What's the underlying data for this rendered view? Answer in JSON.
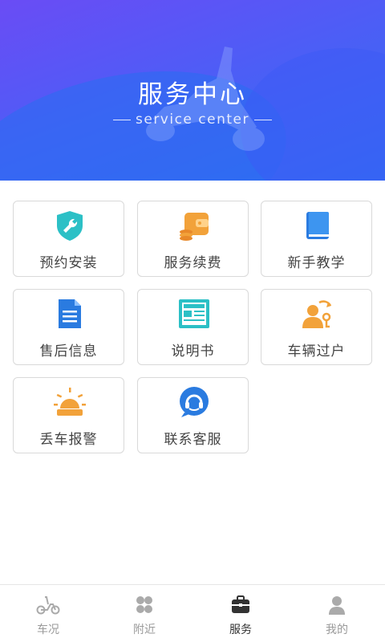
{
  "header": {
    "title": "服务中心",
    "subtitle": "service center"
  },
  "services": [
    {
      "label": "预约安装",
      "icon": "shield-wrench-icon"
    },
    {
      "label": "服务续费",
      "icon": "wallet-coins-icon"
    },
    {
      "label": "新手教学",
      "icon": "book-icon"
    },
    {
      "label": "售后信息",
      "icon": "document-icon"
    },
    {
      "label": "说明书",
      "icon": "manual-screen-icon"
    },
    {
      "label": "车辆过户",
      "icon": "user-transfer-icon"
    },
    {
      "label": "丢车报警",
      "icon": "alarm-light-icon"
    },
    {
      "label": "联系客服",
      "icon": "headset-chat-icon"
    }
  ],
  "tabbar": [
    {
      "label": "车况",
      "icon": "scooter-icon"
    },
    {
      "label": "附近",
      "icon": "nearby-icon"
    },
    {
      "label": "服务",
      "icon": "briefcase-icon"
    },
    {
      "label": "我的",
      "icon": "person-icon"
    }
  ],
  "colors": {
    "banner_start": "#6a4cf5",
    "banner_end": "#2f6ff2",
    "icon_teal": "#2cc0c6",
    "icon_orange": "#f2a23a",
    "icon_blue": "#2a7be0"
  }
}
